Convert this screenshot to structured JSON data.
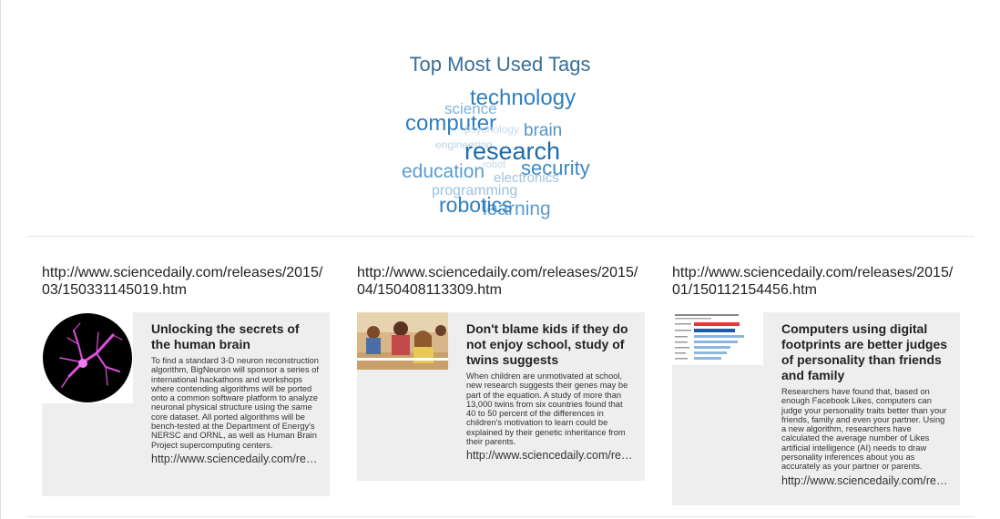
{
  "page": {
    "title": "Top Most Used Tags"
  },
  "tags": [
    {
      "label": "technology",
      "color": "#2f7fbd"
    },
    {
      "label": "science",
      "color": "#7fb3d9"
    },
    {
      "label": "computer",
      "color": "#2f7fbd"
    },
    {
      "label": "psychology",
      "color": "#c6daea"
    },
    {
      "label": "brain",
      "color": "#4f95cc"
    },
    {
      "label": "engineering",
      "color": "#bcd4e8"
    },
    {
      "label": "research",
      "color": "#1f6aa8"
    },
    {
      "label": "education",
      "color": "#5a9ccf"
    },
    {
      "label": "robot",
      "color": "#c6daea"
    },
    {
      "label": "security",
      "color": "#3e88c5"
    },
    {
      "label": "electronics",
      "color": "#a0c2df"
    },
    {
      "label": "programming",
      "color": "#9fc1de"
    },
    {
      "label": "learning",
      "color": "#5a9ccf"
    },
    {
      "label": "robotics",
      "color": "#2f7fbd"
    }
  ],
  "cards": [
    {
      "url": "http://www.sciencedaily.com/releases/2015/03/150331145019.htm",
      "headline": "Unlocking the secrets of the human brain",
      "description": "To find a standard 3-D neuron reconstruction algorithm, BigNeuron will sponsor a series of international hackathons and workshops where contending algorithms will be ported onto a common software platform to analyze neuronal physical structure using the same core dataset. All ported algorithms will be bench-tested at the Department of Energy's NERSC and ORNL, as well as Human Brain Project supercomputing centers.",
      "link": "http://www.sciencedaily.com/releases/2015/03/150331145019.htm"
    },
    {
      "url": "http://www.sciencedaily.com/releases/2015/04/150408113309.htm",
      "headline": "Don't blame kids if they do not enjoy school, study of twins suggests",
      "description": "When children are unmotivated at school, new research suggests their genes may be part of the equation. A study of more than 13,000 twins from six countries found that 40 to 50 percent of the differences in children's motivation to learn could be explained by their genetic inheritance from their parents.",
      "link": "http://www.sciencedaily.com/releases/2015/04/150408113309.htm"
    },
    {
      "url": "http://www.sciencedaily.com/releases/2015/01/150112154456.htm",
      "headline": "Computers using digital footprints are better judges of personality than friends and family",
      "description": "Researchers have found that, based on enough Facebook Likes, computers can judge your personality traits better than your friends, family and even your partner. Using a new algorithm, researchers have calculated the average number of Likes artificial intelligence (AI) needs to draw personality inferences about you as accurately as your partner or parents.",
      "link": "http://www.sciencedaily.com/releases/2015/01/150112154456.htm"
    }
  ]
}
